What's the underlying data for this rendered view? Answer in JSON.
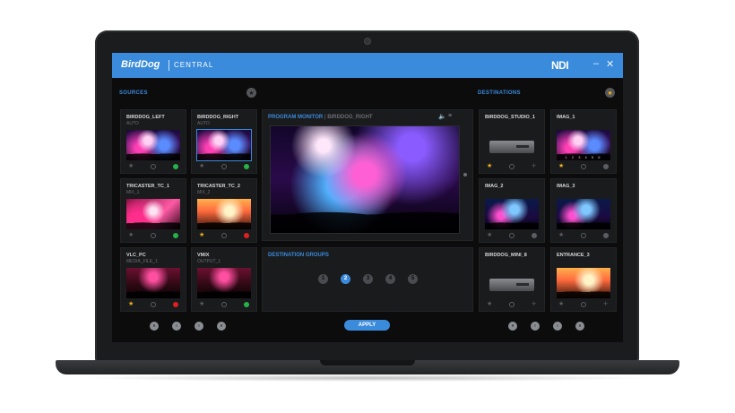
{
  "app": {
    "brand": "BirdDog",
    "product": "CENTRAL",
    "ndi": "NDI",
    "minimize": "–",
    "close": "✕",
    "accent": "#3a8bdc"
  },
  "sources": {
    "label": "SOURCES",
    "tiles": [
      {
        "name": "BIRDDOG_LEFT",
        "sub": "AUTO"
      },
      {
        "name": "BIRDDOG_RIGHT",
        "sub": "AUTO"
      },
      {
        "name": "TRICASTER_TC_1",
        "sub": "MIX_1"
      },
      {
        "name": "TRICASTER_TC_2",
        "sub": "MIX_2"
      },
      {
        "name": "VLC_PC",
        "sub": "MEDIA_FILE_1"
      },
      {
        "name": "VMIX",
        "sub": "OUTPUT_1"
      }
    ]
  },
  "program_monitor": {
    "label": "PROGRAM MONITOR",
    "separator": "|",
    "source": "BIRDDOG_RIGHT",
    "volume_icon": "🔈",
    "menu_icon": "≡"
  },
  "destination_groups": {
    "label": "DESTINATION GROUPS",
    "groups": [
      "1",
      "2",
      "3",
      "4",
      "5"
    ],
    "active": "2"
  },
  "destinations": {
    "label": "DESTINATIONS",
    "tiles": [
      {
        "name": "BIRDDOG_STUDIO_1"
      },
      {
        "name": "IMAG_1",
        "overlay": "1 2 3 4 5 6"
      },
      {
        "name": "IMAG_2"
      },
      {
        "name": "IMAG_3"
      },
      {
        "name": "BIRDDOG_MINI_8"
      },
      {
        "name": "ENTRANCE_3"
      }
    ]
  },
  "footer": {
    "apply_label": "APPLY",
    "first": "«",
    "prev": "‹",
    "next": "›",
    "last": "»"
  },
  "icons": {
    "star": "★",
    "plus": "+"
  }
}
